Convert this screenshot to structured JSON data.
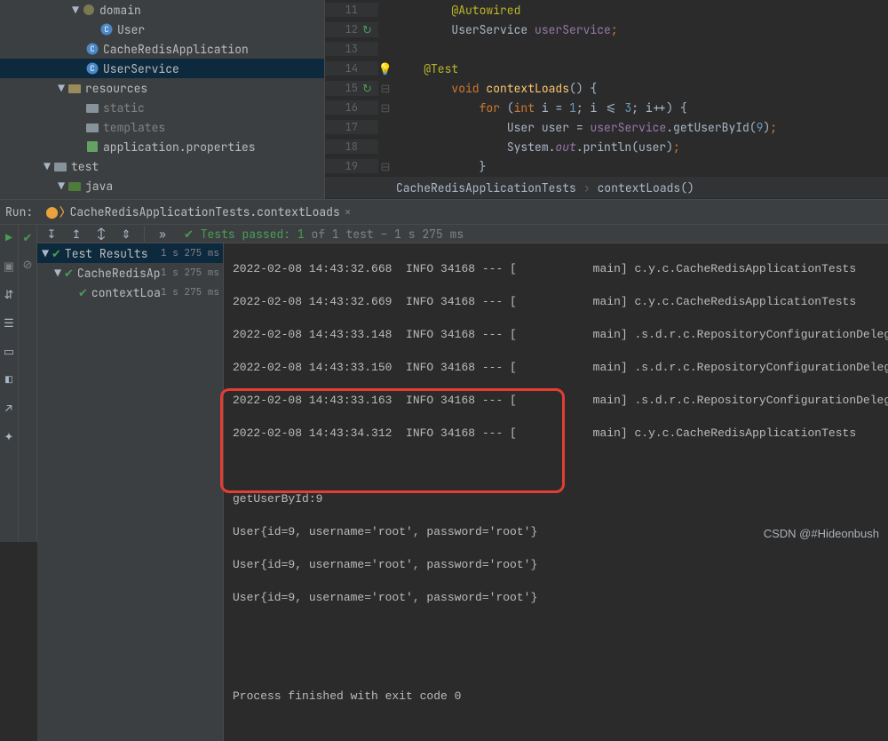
{
  "tree": {
    "domain": "domain",
    "user": "User",
    "app": "CacheRedisApplication",
    "service": "UserService",
    "resources": "resources",
    "static": "static",
    "templates": "templates",
    "appProps": "application.properties",
    "test": "test",
    "java": "java"
  },
  "editor": {
    "lines": [
      {
        "n": 11
      },
      {
        "n": 12
      },
      {
        "n": 13
      },
      {
        "n": 14
      },
      {
        "n": 15
      },
      {
        "n": 16
      },
      {
        "n": 17
      },
      {
        "n": 18
      },
      {
        "n": 19
      }
    ],
    "anno_autowired": "@Autowired",
    "type_userservice": "UserService",
    "field_userservice": "userService",
    "anno_test": "@Test",
    "kw_void": "void",
    "m_contextloads": "contextLoads",
    "kw_for": "for",
    "kw_int": "int",
    "loop": "i = 1; i <= 3; i++",
    "type_user": "User",
    "var_user": "user",
    "call_getuser": ".getUserById(",
    "arg9": "9",
    "system": "System.",
    "out": "out",
    "println": ".println(user)"
  },
  "breadcrumb": {
    "a": "CacheRedisApplicationTests",
    "b": "contextLoads()"
  },
  "runTab": {
    "label": "Run:",
    "title": "CacheRedisApplicationTests.contextLoads"
  },
  "toolbar": {
    "passedPrefix": "Tests passed: 1",
    "passedSuffix": " of 1 test – 1 s 275 ms"
  },
  "testTree": {
    "root": "Test Results",
    "rootTime": "1 s 275 ms",
    "cls": "CacheRedisAp",
    "clsTime": "1 s 275 ms",
    "m": "contextLoa",
    "mTime": "1 s 275 ms"
  },
  "console": {
    "l1": "2022-02-08 14:43:32.668  INFO 34168 --- [           main] c.y.c.CacheRedisApplicationTests",
    "l2": "2022-02-08 14:43:32.669  INFO 34168 --- [           main] c.y.c.CacheRedisApplicationTests",
    "l3": "2022-02-08 14:43:33.148  INFO 34168 --- [           main] .s.d.r.c.RepositoryConfigurationDelegate",
    "l4": "2022-02-08 14:43:33.150  INFO 34168 --- [           main] .s.d.r.c.RepositoryConfigurationDelegate",
    "l5": "2022-02-08 14:43:33.163  INFO 34168 --- [           main] .s.d.r.c.RepositoryConfigurationDelegate",
    "l6": "2022-02-08 14:43:34.312  INFO 34168 --- [           main] c.y.c.CacheRedisApplicationTests",
    "g1": "getUserById:9",
    "u1": "User{id=9, username='root', password='root'}",
    "u2": "User{id=9, username='root', password='root'}",
    "u3": "User{id=9, username='root', password='root'}",
    "exit": "Process finished with exit code 0"
  },
  "watermark": "CSDN @#Hideonbush"
}
